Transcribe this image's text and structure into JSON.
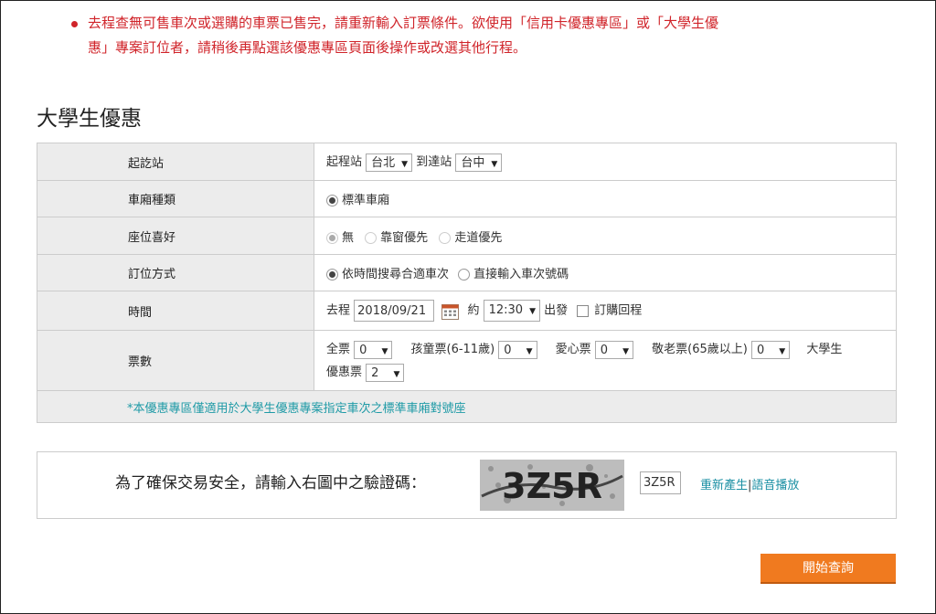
{
  "error": {
    "line1": "去程查無可售車次或選購的車票已售完，請重新輸入訂票條件。欲使用「信用卡優惠專區」或「大學生優",
    "line2": "惠」專案訂位者，請稍後再點選該優惠專區頁面後操作或改選其他行程。",
    "color": "#d0242a"
  },
  "title": "大學生優惠",
  "rows": {
    "station": {
      "label": "起訖站",
      "from_label": "起程站",
      "from_value": "台北",
      "to_label": "到達站",
      "to_value": "台中"
    },
    "car_type": {
      "label": "車廂種類",
      "option": "標準車廂"
    },
    "seat": {
      "label": "座位喜好",
      "options": [
        "無",
        "靠窗優先",
        "走道優先"
      ]
    },
    "booking_method": {
      "label": "訂位方式",
      "options": [
        "依時間搜尋合適車次",
        "直接輸入車次號碼"
      ]
    },
    "time": {
      "label": "時間",
      "outbound_label": "去程",
      "date": "2018/09/21",
      "about": "約",
      "time_value": "12:30",
      "depart": "出發",
      "return_label": "訂購回程"
    },
    "tickets": {
      "label": "票數",
      "adult_label": "全票",
      "adult_value": "0",
      "child_label": "孩童票(6-11歲)",
      "child_value": "0",
      "disabled_label": "愛心票",
      "disabled_value": "0",
      "senior_label": "敬老票(65歲以上)",
      "senior_value": "0",
      "student_label_1": "大學生",
      "student_label_2": "優惠票",
      "student_value": "2"
    },
    "note": "*本優惠專區僅適用於大學生優惠專案指定車次之標準車廂對號座"
  },
  "captcha": {
    "label": "為了確保交易安全，請輸入右圖中之驗證碼：",
    "image_text": "3Z5R",
    "input_value": "3Z5R",
    "regenerate": "重新產生",
    "separator": "|",
    "audio": "語音播放"
  },
  "search_button": "開始查詢",
  "colors": {
    "accent": "#f07a1f",
    "link": "#1a8fa3",
    "label_bg": "#ececec"
  }
}
